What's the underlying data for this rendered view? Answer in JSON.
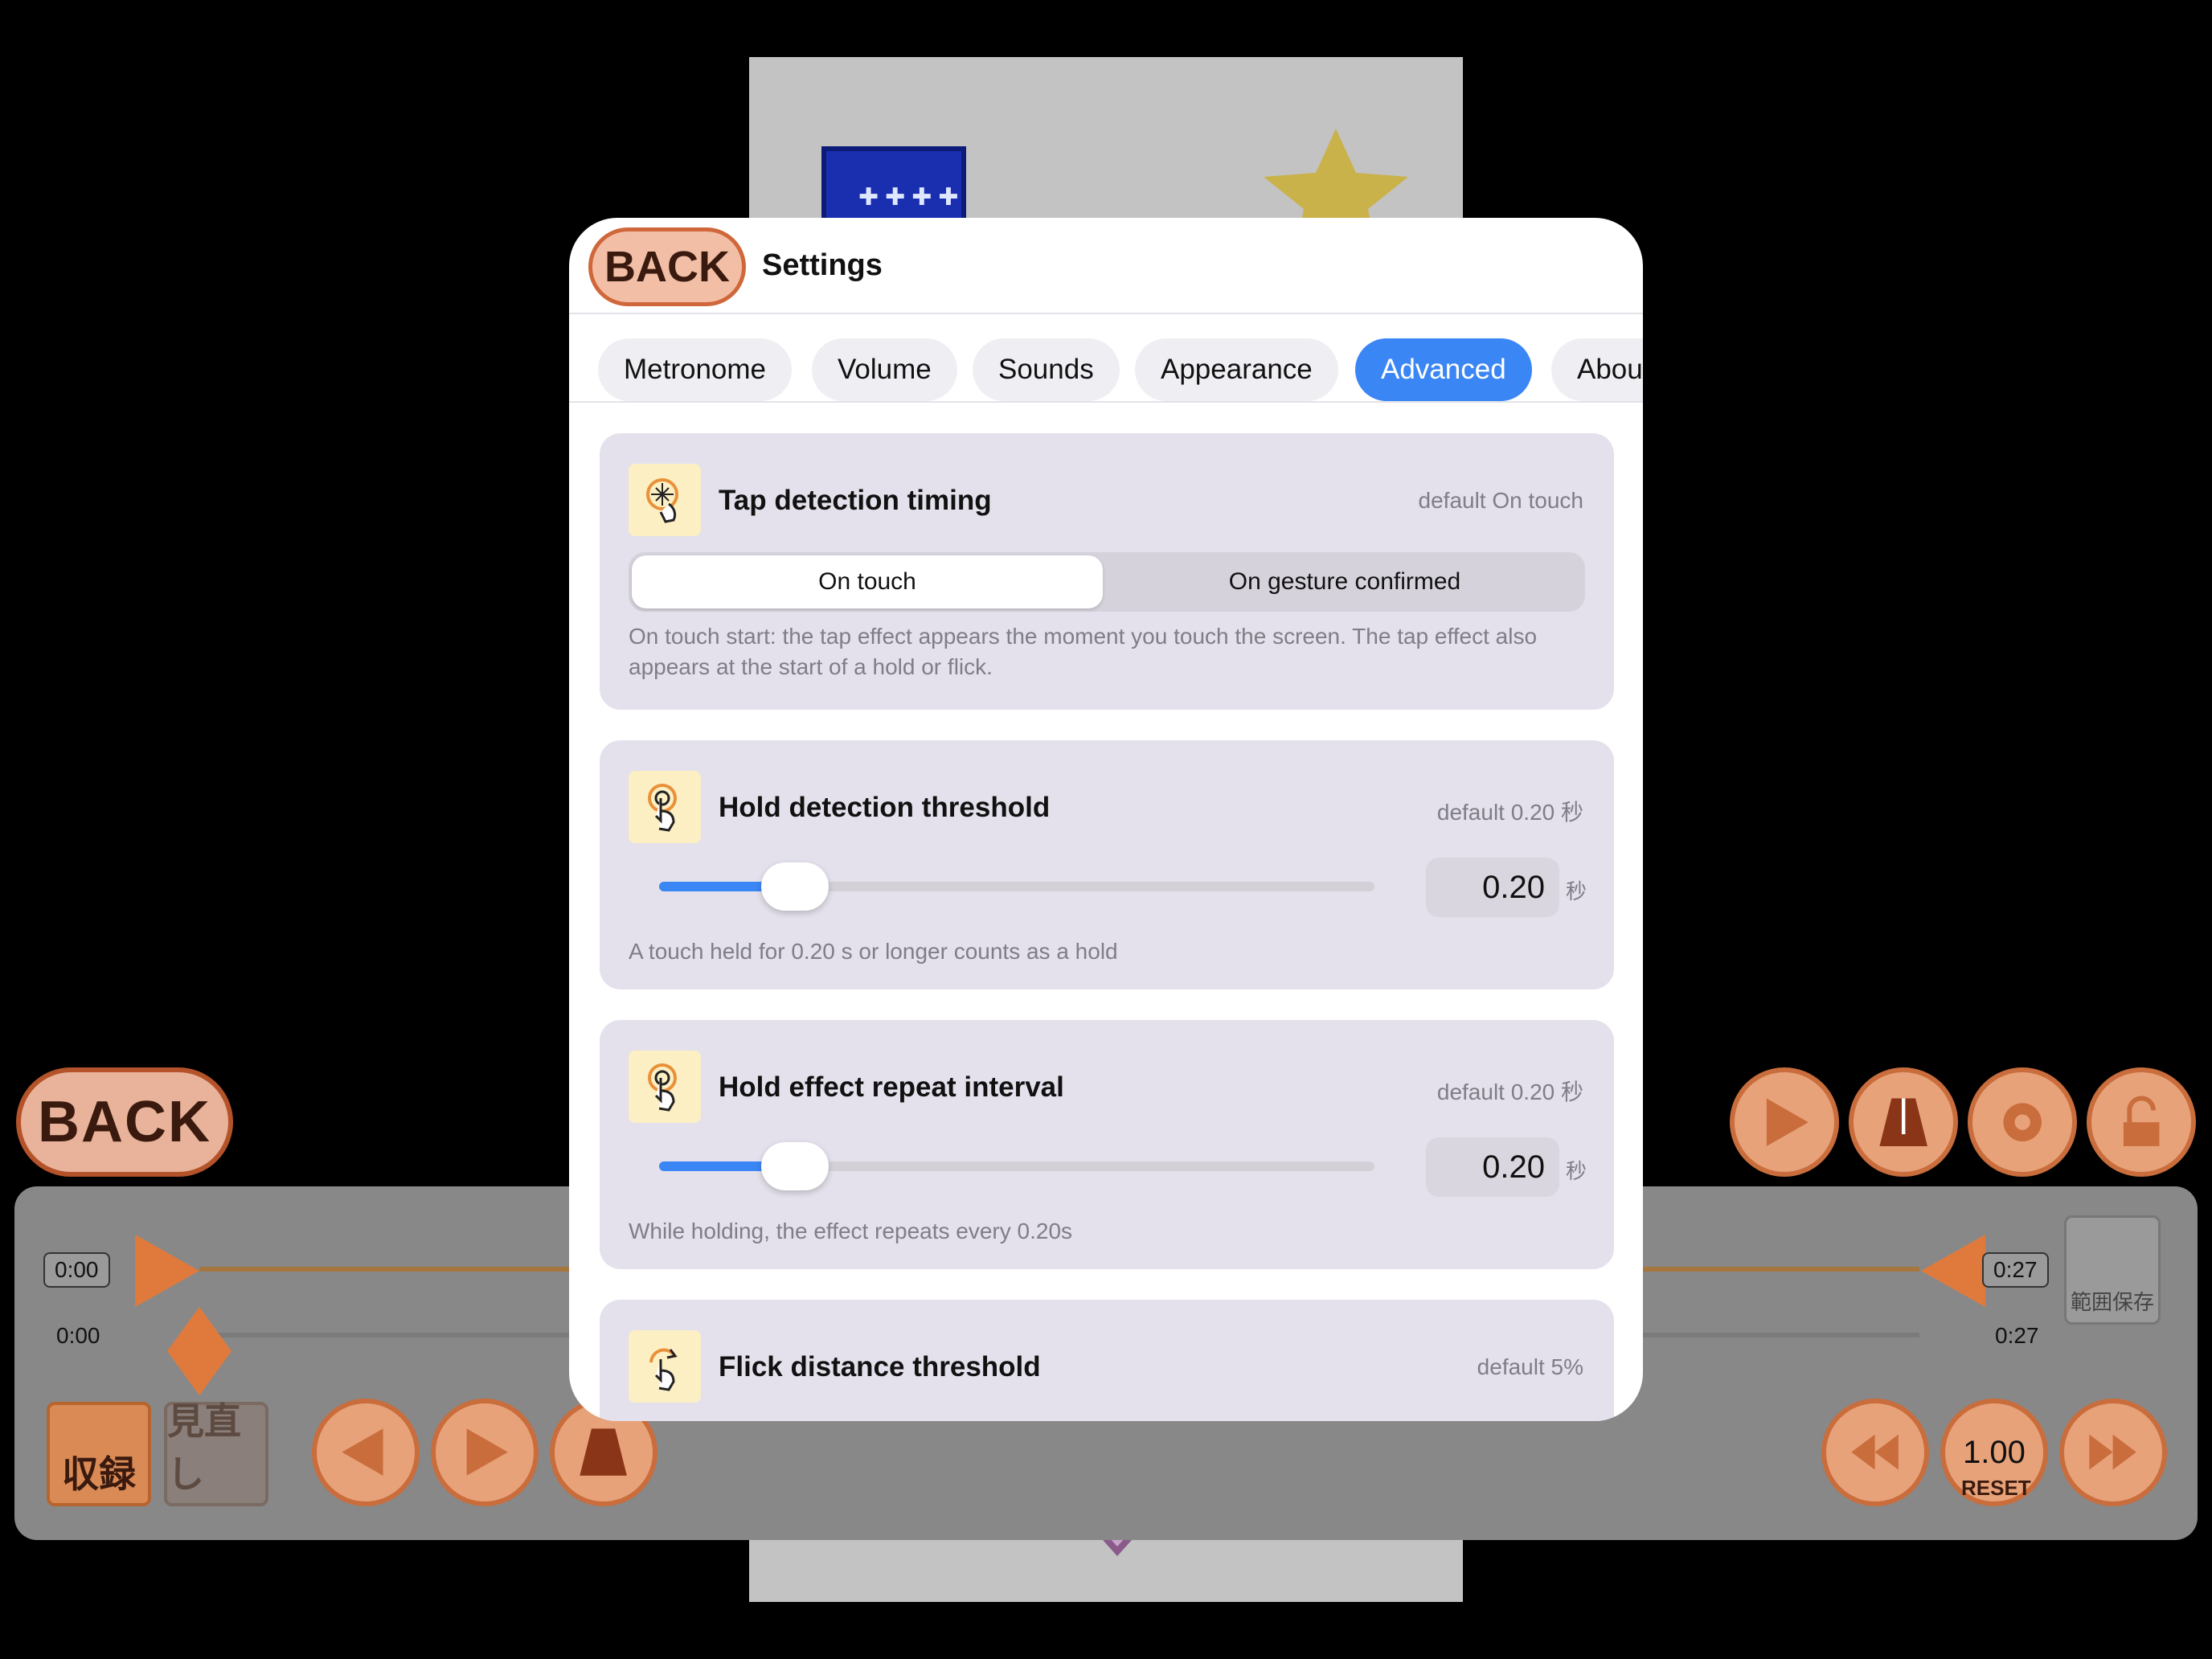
{
  "background": {
    "back_label": "BACK",
    "time_start_boxed": "0:00",
    "time_start_plain": "0:00",
    "time_end_boxed": "0:27",
    "time_end_plain": "0:27",
    "record_label": "収録",
    "review_label": "見直し",
    "save_range_label": "範囲保存",
    "speed_value": "1.00",
    "reset_label": "RESET",
    "book_dots": "✚✚✚✚"
  },
  "modal": {
    "back_label": "BACK",
    "title": "Settings",
    "tabs": [
      {
        "label": "Metronome",
        "active": false
      },
      {
        "label": "Volume",
        "active": false
      },
      {
        "label": "Sounds",
        "active": false
      },
      {
        "label": "Appearance",
        "active": false
      },
      {
        "label": "Advanced",
        "active": true
      },
      {
        "label": "About",
        "active": false
      }
    ]
  },
  "settings": {
    "tap_timing": {
      "title": "Tap detection timing",
      "default": "default On touch",
      "options": [
        "On touch",
        "On gesture confirmed"
      ],
      "selected": "On touch",
      "description": "On touch start: the tap effect appears the moment you touch the screen. The tap effect also appears at the start of a hold or flick.",
      "icon": "tap-timing-icon"
    },
    "hold_threshold": {
      "title": "Hold detection threshold",
      "default": "default 0.20 秒",
      "value": "0.20",
      "unit": "秒",
      "slider_fraction": 0.19,
      "description": "A touch held for 0.20 s or longer counts as a hold",
      "icon": "hold-icon"
    },
    "hold_repeat": {
      "title": "Hold effect repeat interval",
      "default": "default 0.20 秒",
      "value": "0.20",
      "unit": "秒",
      "slider_fraction": 0.19,
      "description": "While holding, the effect repeats every 0.20s",
      "icon": "hold-repeat-icon"
    },
    "flick_distance": {
      "title": "Flick distance threshold",
      "default": "default 5%",
      "icon": "flick-icon"
    }
  },
  "colors": {
    "accent": "#3b86f5",
    "card_bg": "#e4e1ec",
    "orange": "#e8a27a"
  }
}
